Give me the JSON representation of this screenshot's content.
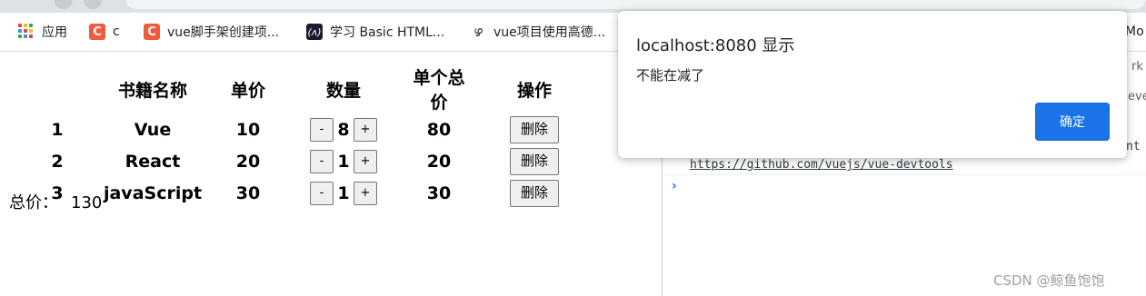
{
  "bookmarks": [
    {
      "label": "应用",
      "icon": "apps-grid-icon"
    },
    {
      "label": "c",
      "icon": "csdn-c-icon"
    },
    {
      "label": "vue脚手架创建项...",
      "icon": "csdn-c-icon"
    },
    {
      "label": "学习 Basic HTML...",
      "icon": "freecodecamp-icon"
    },
    {
      "label": "vue项目使用高德...",
      "icon": "swirl-icon"
    },
    {
      "label": "Mo",
      "icon": ""
    }
  ],
  "table": {
    "headers": [
      "",
      "书籍名称",
      "单价",
      "数量",
      "单个总价",
      "操作"
    ],
    "rows": [
      {
        "id": "1",
        "name": "Vue",
        "price": "10",
        "qty": "8",
        "total": "80"
      },
      {
        "id": "2",
        "name": "React",
        "price": "20",
        "qty": "1",
        "total": "20"
      },
      {
        "id": "3",
        "name": "javaScript",
        "price": "30",
        "qty": "1",
        "total": "30"
      }
    ],
    "minus_label": "-",
    "plus_label": "+",
    "delete_label": "删除"
  },
  "summary": {
    "label": "总价：",
    "value": "130"
  },
  "devtools": {
    "partial_tab_1": "rk",
    "partial_tab_2": "eve",
    "partial_text": "nt",
    "link": "https://github.com/vuejs/vue-devtools",
    "prompt": "›"
  },
  "alert": {
    "title": "localhost:8080 显示",
    "message": "不能在减了",
    "ok_label": "确定"
  },
  "watermark": "CSDN @鲸鱼饱饱",
  "colors": {
    "accent": "#1a73e8",
    "csdn": "#f15a3a"
  }
}
